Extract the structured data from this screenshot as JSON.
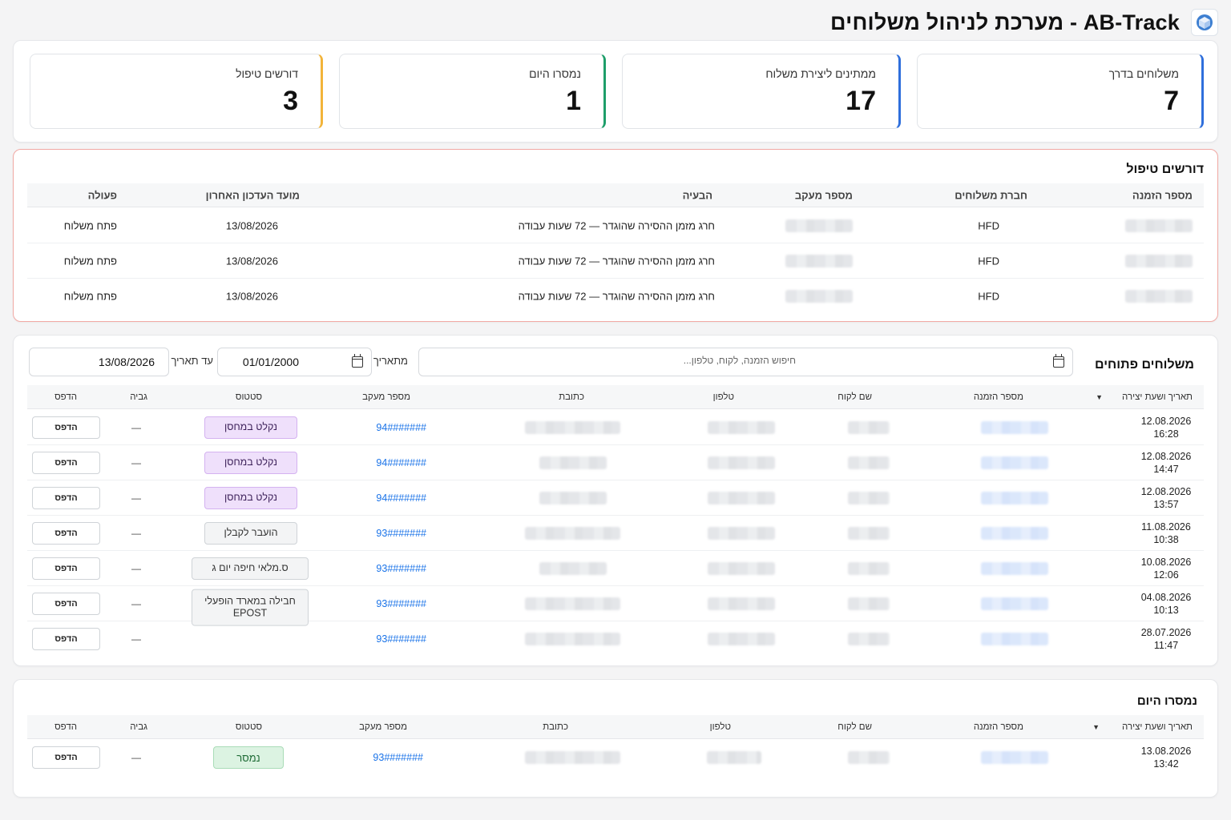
{
  "header": {
    "title": "AB-Track - מערכת לניהול משלוחים"
  },
  "stats": [
    {
      "label": "משלוחים בדרך",
      "value": "7",
      "color": "#2f6fdc"
    },
    {
      "label": "ממתינים ליצירת משלוח",
      "value": "17",
      "color": "#2f6fdc"
    },
    {
      "label": "נמסרו היום",
      "value": "1",
      "color": "#1e9e6a"
    },
    {
      "label": "דורשים טיפול",
      "value": "3",
      "color": "#f2b43a"
    }
  ],
  "attention": {
    "title": "דורשים טיפול",
    "columns": {
      "order": "מספר הזמנה",
      "company": "חברת משלוחים",
      "tracking": "מספר מעקב",
      "issue": "הבעיה",
      "last_update": "מועד העדכון האחרון",
      "action": "פעולה"
    },
    "rows": [
      {
        "company": "HFD",
        "issue": "חרג מזמן ההסירה שהוגדר — 72 שעות עבודה",
        "last_update": "13/08/2026",
        "action": "פתח משלוח"
      },
      {
        "company": "HFD",
        "issue": "חרג מזמן ההסירה שהוגדר — 72 שעות עבודה",
        "last_update": "13/08/2026",
        "action": "פתח משלוח"
      },
      {
        "company": "HFD",
        "issue": "חרג מזמן ההסירה שהוגדר — 72 שעות עבודה",
        "last_update": "13/08/2026",
        "action": "פתח משלוח"
      }
    ]
  },
  "open": {
    "title": "משלוחים פתוחים",
    "search_placeholder": "חיפוש הזמנה, לקוח, טלפון...",
    "from_label": "מתאריך",
    "from_value": "01/01/2000",
    "to_label": "עד תאריך",
    "to_value": "13/08/2026",
    "columns": {
      "created": "תאריך ושעת יצירה",
      "sort": "▼",
      "order": "מספר הזמנה",
      "customer": "שם לקוח",
      "phone": "טלפון",
      "address": "כתובת",
      "tracking": "מספר מעקב",
      "status": "סטטוס",
      "collection": "גביה",
      "print": "הדפס"
    },
    "rows": [
      {
        "date": "12.08.2026",
        "time": "16:28",
        "tracking": "94#######",
        "status": "נקלט במחסן",
        "status_kind": "purple",
        "collection": "—",
        "print": "הדפס"
      },
      {
        "date": "12.08.2026",
        "time": "14:47",
        "tracking": "94#######",
        "status": "נקלט במחסן",
        "status_kind": "purple",
        "collection": "—",
        "print": "הדפס"
      },
      {
        "date": "12.08.2026",
        "time": "13:57",
        "tracking": "94#######",
        "status": "נקלט במחסן",
        "status_kind": "purple",
        "collection": "—",
        "print": "הדפס"
      },
      {
        "date": "11.08.2026",
        "time": "10:38",
        "tracking": "93#######",
        "status": "הועבר לקבלן",
        "status_kind": "gray",
        "collection": "—",
        "print": "הדפס"
      },
      {
        "date": "10.08.2026",
        "time": "12:06",
        "tracking": "93#######",
        "status": "ס.מלאי חיפה יום ג",
        "status_kind": "gray",
        "collection": "—",
        "print": "הדפס"
      },
      {
        "date": "04.08.2026",
        "time": "10:13",
        "tracking": "93#######",
        "status": "חבילה במארד הופעלי EPOST",
        "status_kind": "gray-tall",
        "collection": "—",
        "print": "הדפס"
      },
      {
        "date": "28.07.2026",
        "time": "11:47",
        "tracking": "93#######",
        "status": "",
        "status_kind": "none",
        "collection": "—",
        "print": "הדפס"
      }
    ]
  },
  "delivered": {
    "title": "נמסרו היום",
    "columns": {
      "created": "תאריך ושעת יצירה",
      "sort": "▼",
      "order": "מספר הזמנה",
      "customer": "שם לקוח",
      "phone": "טלפון",
      "address": "כתובת",
      "tracking": "מספר מעקב",
      "status": "סטטוס",
      "collection": "גביה",
      "print": "הדפס"
    },
    "rows": [
      {
        "date": "13.08.2026",
        "time": "13:42",
        "tracking": "93#######",
        "status": "נמסר",
        "collection": "—",
        "print": "הדפס"
      }
    ]
  }
}
